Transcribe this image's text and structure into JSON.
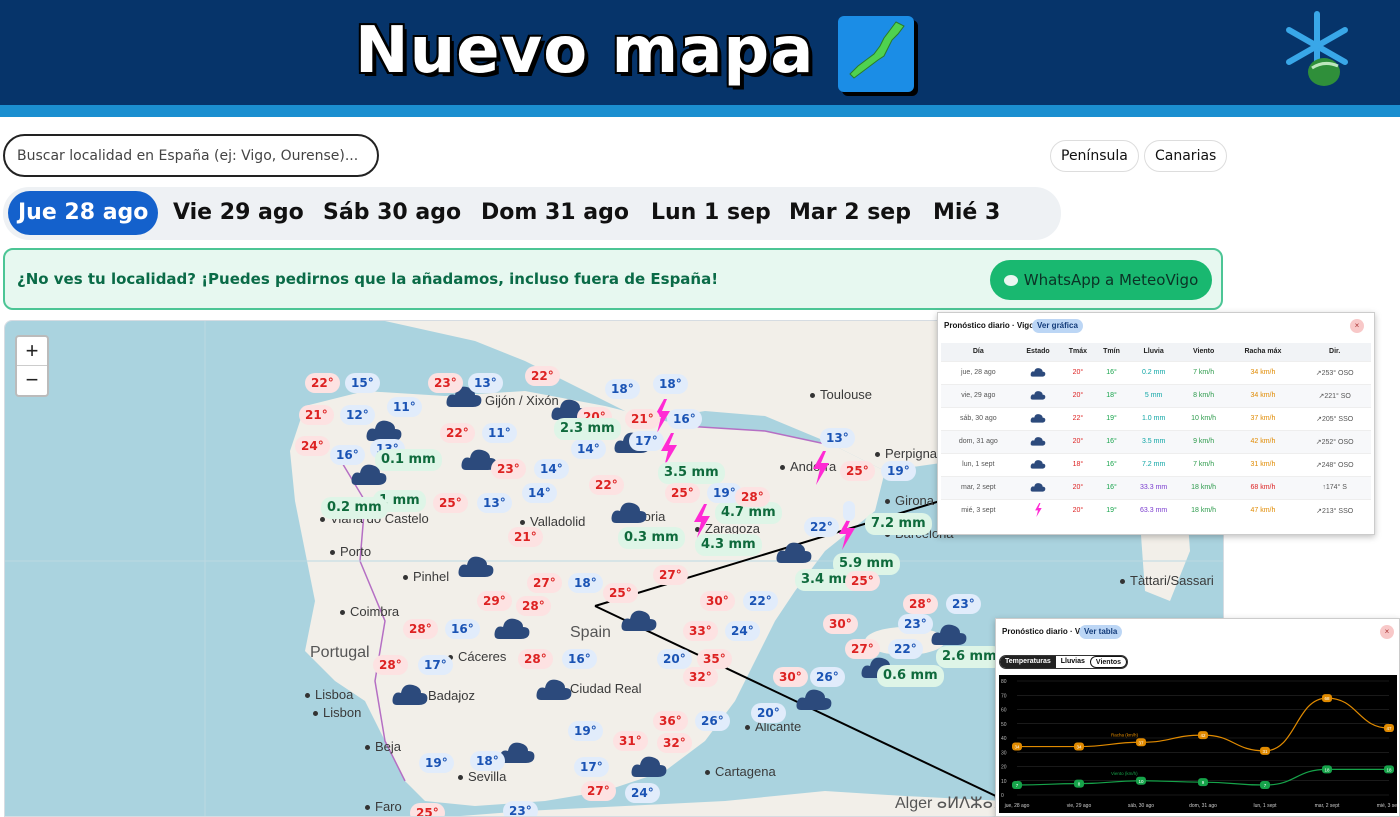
{
  "banner": {
    "title": "Nuevo mapa",
    "emoji_icon": "japan-map-icon",
    "logo_icon": "snowflake-logo-icon"
  },
  "search": {
    "placeholder": "Buscar localidad en España (ej: Vigo, Ourense)..."
  },
  "regions": [
    "Península",
    "Canarias"
  ],
  "days": [
    "Jue 28 ago",
    "Vie 29 ago",
    "Sáb 30 ago",
    "Dom 31 ago",
    "Lun 1 sep",
    "Mar 2 sep",
    "Mié 3 sep"
  ],
  "active_day": "Jue 28 ago",
  "notice": {
    "text": "¿No ves tu localidad? ¡Puedes pedirnos que la añadamos, incluso fuera de España!",
    "button": "WhatsApp a MeteoVigo"
  },
  "map": {
    "zoom_in": "+",
    "zoom_out": "−",
    "cities": [
      "Toulouse",
      "Perpignan",
      "Andorra",
      "Viana do Castelo",
      "Porto",
      "Pinhel",
      "Coimbra",
      "Lisboa",
      "Lisbon",
      "Beja",
      "Faro",
      "Valladolid",
      "Cáceres",
      "Badajoz",
      "Ciudad Real",
      "Sevilla",
      "Alicante",
      "Cartagena",
      "Girona",
      "Barcelona",
      "Zaragoza",
      "Soria",
      "Gijón / Xixón",
      "Tàttari/Sassari",
      "Alger ⴰⵍⴷⵣⴰⵢⴻⵔ"
    ],
    "countries": [
      "Portugal",
      "Spain"
    ],
    "temp_markers": [
      "22°",
      "23°",
      "15°",
      "13°",
      "22°",
      "18°",
      "18°",
      "21°",
      "12°",
      "11°",
      "16°",
      "20°",
      "21°",
      "24°",
      "16°",
      "13°",
      "22°",
      "14°",
      "17°",
      "11°",
      "2.3 mm",
      "3.5 mm",
      "0.1 mm",
      "1 mm",
      "0.2 mm",
      "4.7 mm",
      "4.3 mm",
      "7.2 mm",
      "5.9 mm",
      "3.4 mm",
      "0.3 mm",
      "2.6 mm",
      "0.6 mm",
      "19°",
      "25°",
      "13°",
      "25°",
      "23°",
      "14°",
      "14°",
      "22°",
      "13°",
      "25°",
      "19°",
      "28°",
      "27°",
      "28°",
      "21°",
      "29°",
      "28°",
      "25°",
      "27°",
      "18°",
      "30°",
      "22°",
      "24°",
      "16°",
      "28°",
      "17°",
      "28°",
      "16°",
      "20°",
      "35°",
      "32°",
      "33°",
      "30°",
      "36°",
      "32°",
      "31°",
      "19°",
      "26°",
      "30°",
      "25°",
      "27°",
      "28°",
      "23°",
      "18°",
      "19°",
      "23°",
      "27°",
      "17°",
      "25°",
      "26°",
      "20°",
      "22°",
      "23°",
      "24°",
      "22°"
    ]
  },
  "daily_panel": {
    "title": "Pronóstico diario · Vigo",
    "toggle": "Ver gráfica",
    "close": "×",
    "headers": [
      "Día",
      "Estado",
      "Tmáx",
      "Tmín",
      "Lluvia",
      "Viento",
      "Racha máx",
      "Dir."
    ],
    "rows": [
      [
        "jue, 28 ago",
        "rain-cloud-icon",
        "20°",
        "16°",
        "0.2 mm",
        "7 km/h",
        "34 km/h",
        "↗253° OSO"
      ],
      [
        "vie, 29 ago",
        "rain-cloud-icon",
        "20°",
        "18°",
        "5 mm",
        "8 km/h",
        "34 km/h",
        "↗221° SO"
      ],
      [
        "sáb, 30 ago",
        "rain-cloud-icon",
        "22°",
        "19°",
        "1.0 mm",
        "10 km/h",
        "37 km/h",
        "↗205° SSO"
      ],
      [
        "dom, 31 ago",
        "rain-cloud-icon",
        "20°",
        "16°",
        "3.5 mm",
        "9 km/h",
        "42 km/h",
        "↗252° OSO"
      ],
      [
        "lun, 1 sept",
        "rain-cloud-icon",
        "18°",
        "16°",
        "7.2 mm",
        "7 km/h",
        "31 km/h",
        "↗248° OSO"
      ],
      [
        "mar, 2 sept",
        "rain-cloud-icon",
        "20°",
        "16°",
        "33.3 mm",
        "18 km/h",
        "68 km/h",
        "↑174° S"
      ],
      [
        "mié, 3 sept",
        "lightning-icon",
        "20°",
        "19°",
        "63.3 mm",
        "18 km/h",
        "47 km/h",
        "↗213° SSO"
      ]
    ]
  },
  "chart_panel": {
    "title": "Pronóstico diario · Vigo",
    "toggle": "Ver tabla",
    "close": "×",
    "tabs": [
      "Temperaturas",
      "Lluvias",
      "Vientos"
    ],
    "active_tab": "Vientos"
  },
  "chart_data": {
    "type": "line",
    "categories": [
      "jue, 28 ago",
      "vie, 29 ago",
      "sáb, 30 ago",
      "dom, 31 ago",
      "lun, 1 sept",
      "mar, 2 sept",
      "mié, 3 sept"
    ],
    "series": [
      {
        "name": "Racha (km/h)",
        "values": [
          34,
          34,
          37,
          42,
          31,
          68,
          47
        ],
        "color": "#e08a00"
      },
      {
        "name": "Viento (km/h)",
        "values": [
          7,
          8,
          10,
          9,
          7,
          18,
          18
        ],
        "color": "#16a34a"
      }
    ],
    "ylim": [
      0,
      80
    ],
    "yticks": [
      0,
      10,
      20,
      30,
      40,
      50,
      60,
      70,
      80
    ]
  },
  "colors": {
    "banner": "#06346a",
    "accent": "#1461cc",
    "whatsapp": "#19b870",
    "sea": "#aad3df",
    "land": "#f2efe9",
    "storm": "#ff2ad4"
  }
}
